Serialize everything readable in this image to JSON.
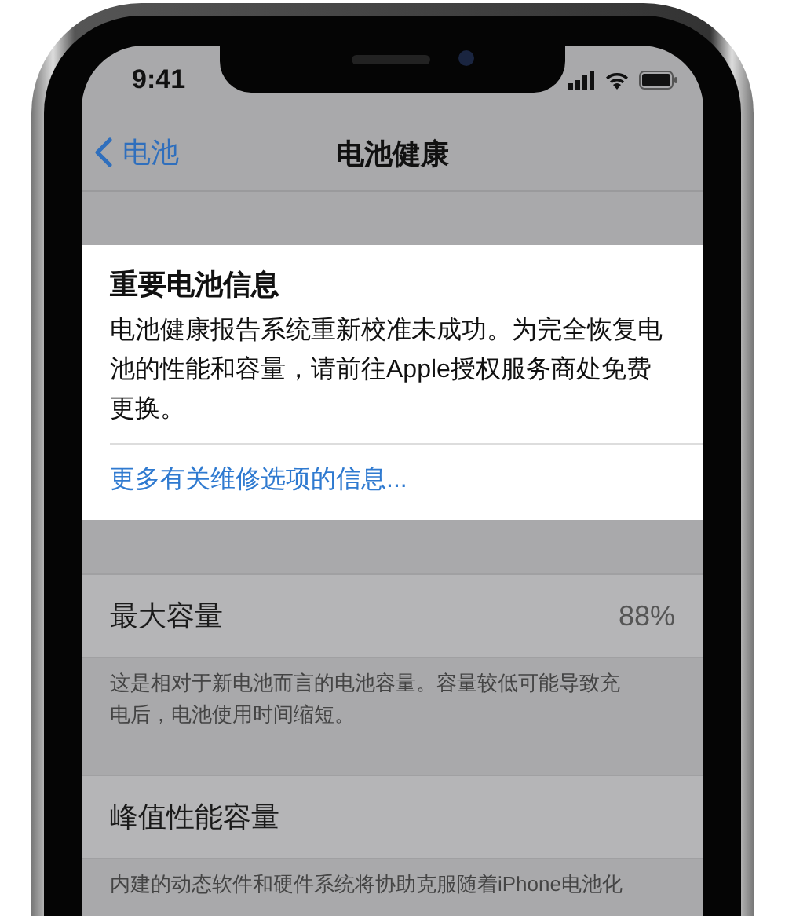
{
  "status_bar": {
    "time": "9:41"
  },
  "nav": {
    "back": "电池",
    "title": "电池健康"
  },
  "notice": {
    "title": "重要电池信息",
    "body": "电池健康报告系统重新校准未成功。为完全恢复电池的性能和容量，请前往Apple授权服务商处免费更换。",
    "link": "更多有关维修选项的信息..."
  },
  "sections": [
    {
      "label": "最大容量",
      "value": "88%",
      "footer": "这是相对于新电池而言的电池容量。容量较低可能导致充电后，电池使用时间缩短。"
    },
    {
      "label": "峰值性能容量",
      "footer": "内建的动态软件和硬件系统将协助克服随着iPhone电池化"
    }
  ]
}
